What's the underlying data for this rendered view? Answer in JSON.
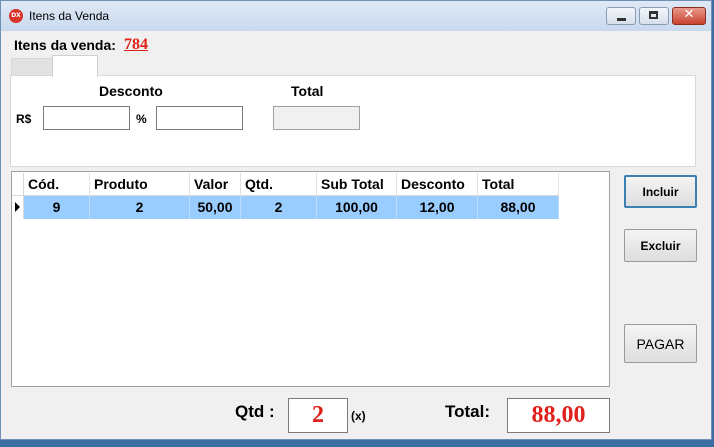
{
  "window": {
    "title": "Itens da Venda",
    "icon_text": "DX",
    "controls": {
      "close_glyph": "✕"
    }
  },
  "sale": {
    "label": "Itens da venda:",
    "number": "784"
  },
  "tabs": [
    {
      "label": ""
    },
    {
      "label": ""
    }
  ],
  "discount_panel": {
    "desconto_label": "Desconto",
    "total_label": "Total",
    "rs_label": "R$",
    "pct_label": "%",
    "rs_value": "",
    "pct_value": "",
    "total_value": ""
  },
  "grid": {
    "columns": [
      "Cód.",
      "Produto",
      "Valor",
      "Qtd.",
      "Sub Total",
      "Desconto",
      "Total"
    ],
    "rows": [
      [
        "9",
        "2",
        "50,00",
        "2",
        "100,00",
        "12,00",
        "88,00"
      ]
    ]
  },
  "buttons": {
    "incluir": "Incluir",
    "excluir": "Excluir",
    "pagar": "PAGAR"
  },
  "footer": {
    "qtd_label": "Qtd :",
    "qtd_value": "2",
    "qtd_suffix": "(x)",
    "total_label": "Total:",
    "total_value": "88,00"
  },
  "colors": {
    "accent_red": "#e0201b",
    "selected_row": "#99ccff"
  }
}
